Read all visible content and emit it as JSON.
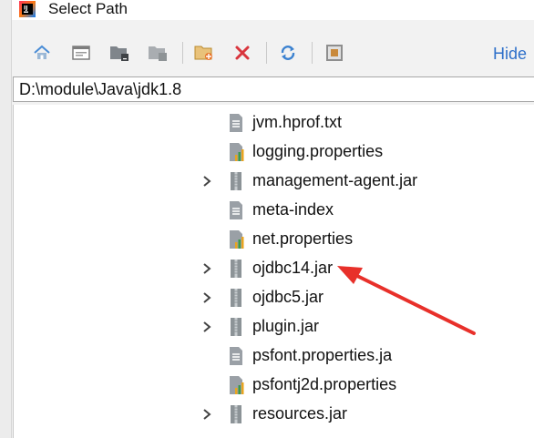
{
  "window": {
    "title": "Select Path"
  },
  "toolbar": {
    "hide_label": "Hide",
    "buttons": [
      {
        "name": "home-button",
        "icon": "home-icon"
      },
      {
        "name": "desktop-button",
        "icon": "desktop-icon"
      },
      {
        "name": "project-button",
        "icon": "project-folder-icon"
      },
      {
        "name": "module-button",
        "icon": "module-folder-icon"
      },
      {
        "name": "new-folder-button",
        "icon": "new-folder-icon"
      },
      {
        "name": "delete-button",
        "icon": "delete-icon"
      },
      {
        "name": "refresh-button",
        "icon": "refresh-icon"
      },
      {
        "name": "show-hidden-button",
        "icon": "show-hidden-icon"
      }
    ]
  },
  "path": {
    "value": "D:\\module\\Java\\jdk1.8"
  },
  "tree": {
    "items": [
      {
        "label": "jvm.hprof.txt",
        "type": "text",
        "expandable": false
      },
      {
        "label": "logging.properties",
        "type": "properties",
        "expandable": false
      },
      {
        "label": "management-agent.jar",
        "type": "jar",
        "expandable": true
      },
      {
        "label": "meta-index",
        "type": "text",
        "expandable": false
      },
      {
        "label": "net.properties",
        "type": "properties",
        "expandable": false
      },
      {
        "label": "ojdbc14.jar",
        "type": "jar",
        "expandable": true
      },
      {
        "label": "ojdbc5.jar",
        "type": "jar",
        "expandable": true
      },
      {
        "label": "plugin.jar",
        "type": "jar",
        "expandable": true
      },
      {
        "label": "psfont.properties.ja",
        "type": "text",
        "expandable": false
      },
      {
        "label": "psfontj2d.properties",
        "type": "properties",
        "expandable": false
      },
      {
        "label": "resources.jar",
        "type": "jar",
        "expandable": true
      }
    ]
  },
  "colors": {
    "accent": "#2d6fc9",
    "delete": "#d9363e",
    "annotation_arrow": "#e8302a"
  }
}
